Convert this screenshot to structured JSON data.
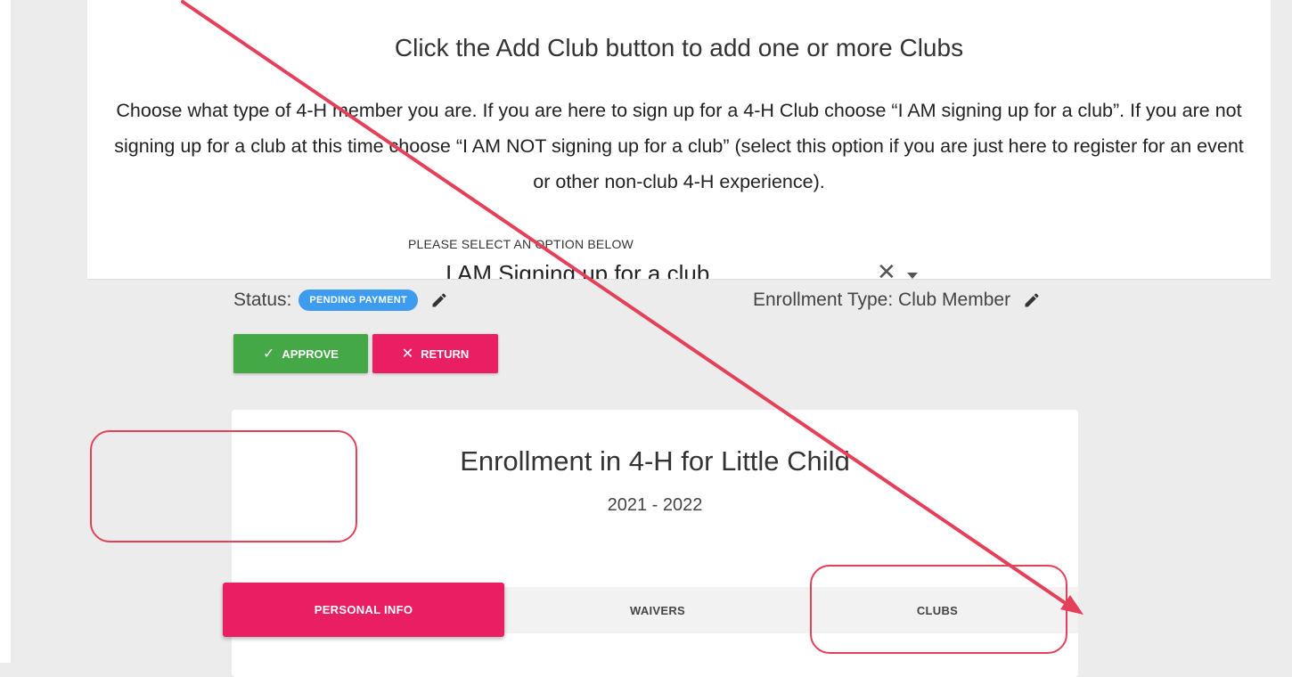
{
  "instructions": {
    "title": "Click the Add Club button to add one or more Clubs",
    "body": "Choose what type of 4-H member you are. If you are here to sign up for a 4-H Club choose “I AM signing up for a club”. If you are not signing up for a club at this time choose “I AM NOT signing up for a club” (select this option if you are just here to register for an event or other non-club 4-H experience).",
    "select_label": "PLEASE SELECT AN OPTION BELOW",
    "select_value": "I AM Signing up for a club"
  },
  "status": {
    "label": "Status:",
    "badge": "PENDING PAYMENT",
    "badge_color": "#3d9cf0"
  },
  "enrollment_type": {
    "label": "Enrollment Type: Club Member"
  },
  "actions": {
    "approve_label": "APPROVE",
    "return_label": "RETURN",
    "approve_color": "#43a845",
    "return_color": "#e91e63"
  },
  "card": {
    "title": "Enrollment in 4-H for Little Child",
    "year": "2021 - 2022"
  },
  "tabs": [
    {
      "label": "PERSONAL INFO",
      "active": true
    },
    {
      "label": "WAIVERS",
      "active": false
    },
    {
      "label": "CLUBS",
      "active": false
    }
  ],
  "annotation_color": "#e5405a"
}
